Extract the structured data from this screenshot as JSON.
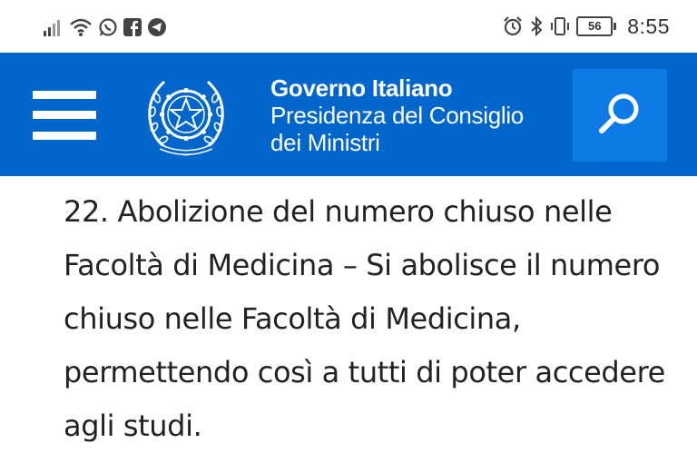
{
  "status_bar": {
    "left_icons": [
      "signal-icon",
      "wifi-icon",
      "whatsapp-icon",
      "facebook-icon",
      "telegram-icon"
    ],
    "right_icons": [
      "alarm-icon",
      "bluetooth-icon",
      "vibrate-icon"
    ],
    "battery_level": "56",
    "time": "8:55"
  },
  "header": {
    "background": "#0066cc",
    "title_bold": "Governo Italiano",
    "title_line2": "Presidenza del Consiglio",
    "title_line3": "dei Ministri",
    "emblem_text": "REPUBBLICA ITALIANA",
    "menu_icon": "hamburger-menu-icon",
    "search_icon": "search-icon"
  },
  "article": {
    "text": "22. Abolizione del numero chiuso nelle Facoltà di Medicina – Si abolisce il numero chiuso nelle Facoltà di Medicina, permettendo così a tutti di poter accedere agli studi."
  }
}
